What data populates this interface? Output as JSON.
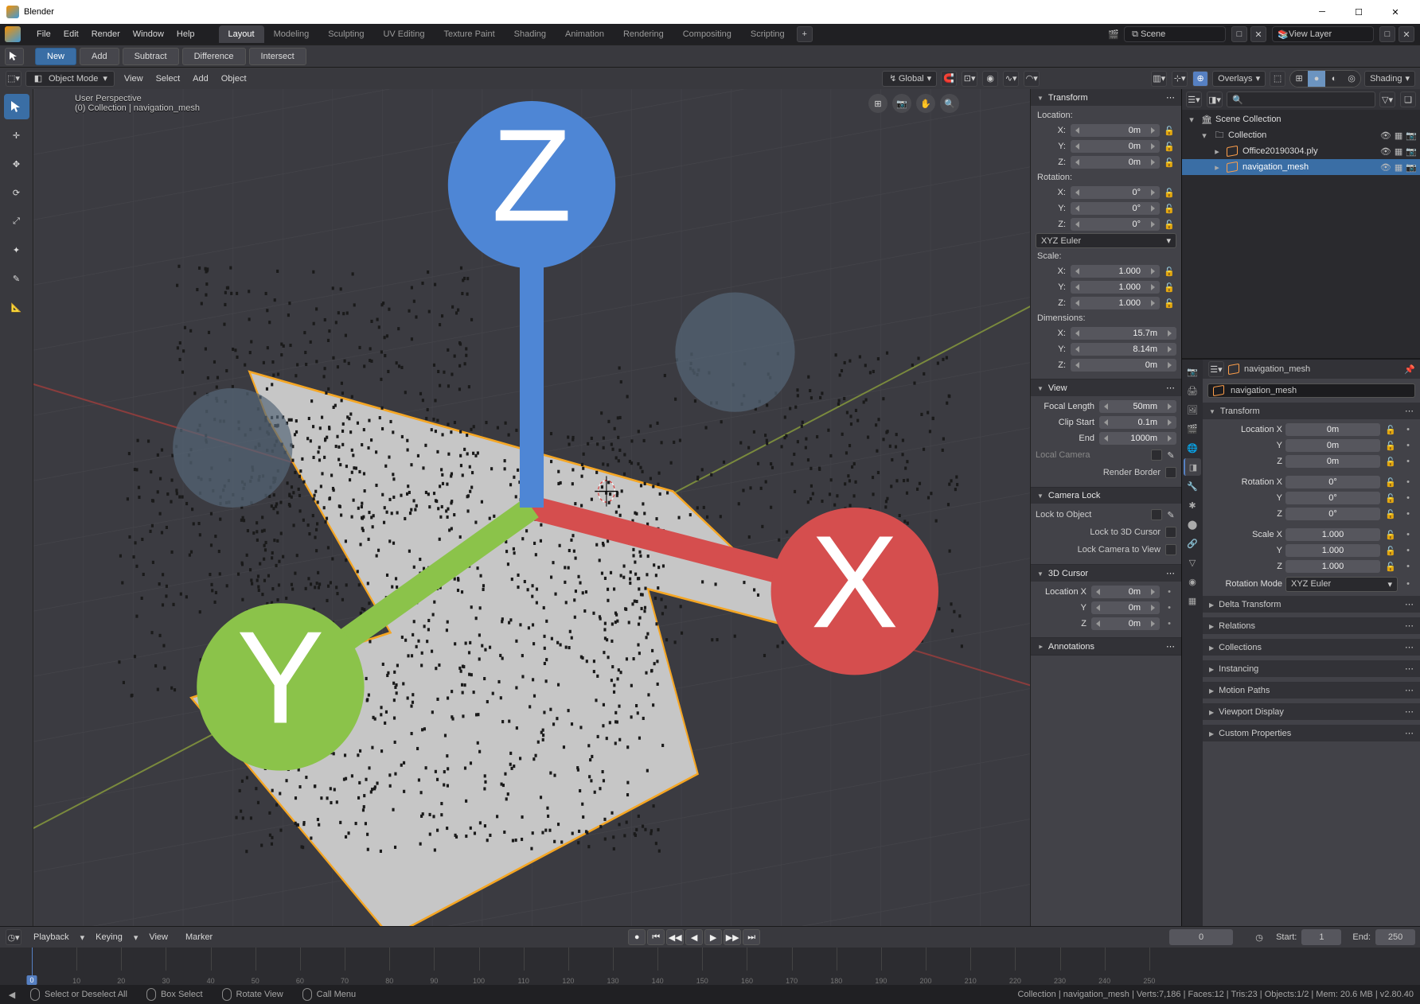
{
  "window_title": "Blender",
  "menus": [
    "File",
    "Edit",
    "Render",
    "Window",
    "Help"
  ],
  "workspaces": [
    "Layout",
    "Modeling",
    "Sculpting",
    "UV Editing",
    "Texture Paint",
    "Shading",
    "Animation",
    "Rendering",
    "Compositing",
    "Scripting"
  ],
  "active_workspace": "Layout",
  "scene_name": "Scene",
  "view_layer": "View Layer",
  "bool_ops": {
    "new": "New",
    "add": "Add",
    "subtract": "Subtract",
    "difference": "Difference",
    "intersect": "Intersect"
  },
  "header": {
    "mode": "Object Mode",
    "menus": [
      "View",
      "Select",
      "Add",
      "Object"
    ],
    "orientation": "Global",
    "overlays": "Overlays",
    "shading": "Shading"
  },
  "viewport": {
    "title": "User Perspective",
    "context": "(0) Collection | navigation_mesh"
  },
  "npanel": {
    "transform": "Transform",
    "location": "Location:",
    "rotation": "Rotation:",
    "rotmode": "XYZ Euler",
    "scale": "Scale:",
    "dimensions": "Dimensions:",
    "loc": {
      "x": "0m",
      "y": "0m",
      "z": "0m"
    },
    "rot": {
      "x": "0°",
      "y": "0°",
      "z": "0°"
    },
    "scl": {
      "x": "1.000",
      "y": "1.000",
      "z": "1.000"
    },
    "dim": {
      "x": "15.7m",
      "y": "8.14m",
      "z": "0m"
    },
    "view": "View",
    "focal": "Focal Length",
    "focal_v": "50mm",
    "clipstart": "Clip Start",
    "clipstart_v": "0.1m",
    "clipend": "End",
    "clipend_v": "1000m",
    "localcam": "Local Camera",
    "renderborder": "Render Border",
    "cameralock": "Camera Lock",
    "locktoobj": "Lock to Object",
    "lock3dcursor": "Lock to 3D Cursor",
    "lockcamview": "Lock Camera to View",
    "cursor3d": "3D Cursor",
    "cursloc": {
      "lx": "Location X",
      "x": "0m",
      "y": "0m",
      "z": "0m"
    },
    "annotations": "Annotations"
  },
  "outliner": {
    "root": "Scene Collection",
    "coll": "Collection",
    "obj1": "Office20190304.ply",
    "obj2": "navigation_mesh"
  },
  "props": {
    "breadcrumb": "navigation_mesh",
    "name": "navigation_mesh",
    "transform": "Transform",
    "rows": [
      {
        "l": "Location X",
        "v": "0m"
      },
      {
        "l": "Y",
        "v": "0m"
      },
      {
        "l": "Z",
        "v": "0m"
      },
      {
        "l": "Rotation X",
        "v": "0°"
      },
      {
        "l": "Y",
        "v": "0°"
      },
      {
        "l": "Z",
        "v": "0°"
      },
      {
        "l": "Scale X",
        "v": "1.000"
      },
      {
        "l": "Y",
        "v": "1.000"
      },
      {
        "l": "Z",
        "v": "1.000"
      }
    ],
    "rotmode": {
      "l": "Rotation Mode",
      "v": "XYZ Euler"
    },
    "panels": [
      "Delta Transform",
      "Relations",
      "Collections",
      "Instancing",
      "Motion Paths",
      "Viewport Display",
      "Custom Properties"
    ]
  },
  "timeline": {
    "playback": "Playback",
    "keying": "Keying",
    "view": "View",
    "marker": "Marker",
    "current": "0",
    "start_l": "Start:",
    "start": "1",
    "end_l": "End:",
    "end": "250",
    "ticks": [
      0,
      10,
      20,
      30,
      40,
      50,
      60,
      70,
      80,
      90,
      100,
      110,
      120,
      130,
      140,
      150,
      160,
      170,
      180,
      190,
      200,
      210,
      220,
      230,
      240,
      250
    ]
  },
  "status": {
    "hints": [
      {
        "icon": "mouse",
        "text": "Select or Deselect All"
      },
      {
        "icon": "mouse",
        "text": "Box Select"
      },
      {
        "icon": "mouse",
        "text": "Rotate View"
      },
      {
        "icon": "mouse",
        "text": "Call Menu"
      }
    ],
    "right": "Collection | navigation_mesh | Verts:7,186 | Faces:12 | Tris:23 | Objects:1/2 | Mem: 20.6 MB | v2.80.40"
  }
}
